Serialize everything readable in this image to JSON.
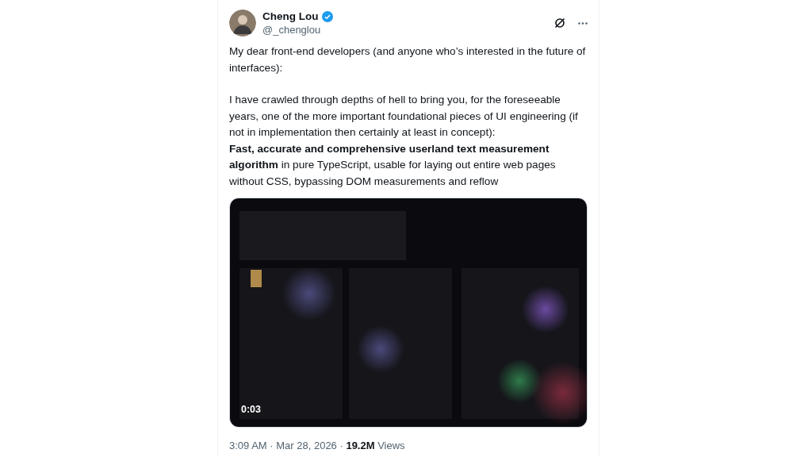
{
  "author": {
    "name": "Cheng Lou",
    "handle": "@_chenglou",
    "verified": true
  },
  "paragraphs": [
    {
      "lines": [
        "My dear front-end developers (and anyone who’s interested in the future of interfaces):"
      ]
    },
    {
      "lines": [
        "I have crawled through depths of hell to bring you, for the foreseeable years, one of the more important foundational pieces of UI engineering (if not in implementation then certainly at least in concept):",
        "**Fast, accurate and comprehensive userland text measurement algorithm** in pure TypeScript, usable for laying out entire web pages without CSS, bypassing DOM measurements and reflow"
      ]
    }
  ],
  "media": {
    "kind": "picture",
    "duration": "0:03"
  },
  "footer": "3:09 AM · Mar 28, 2026 · **19.2M** Views"
}
